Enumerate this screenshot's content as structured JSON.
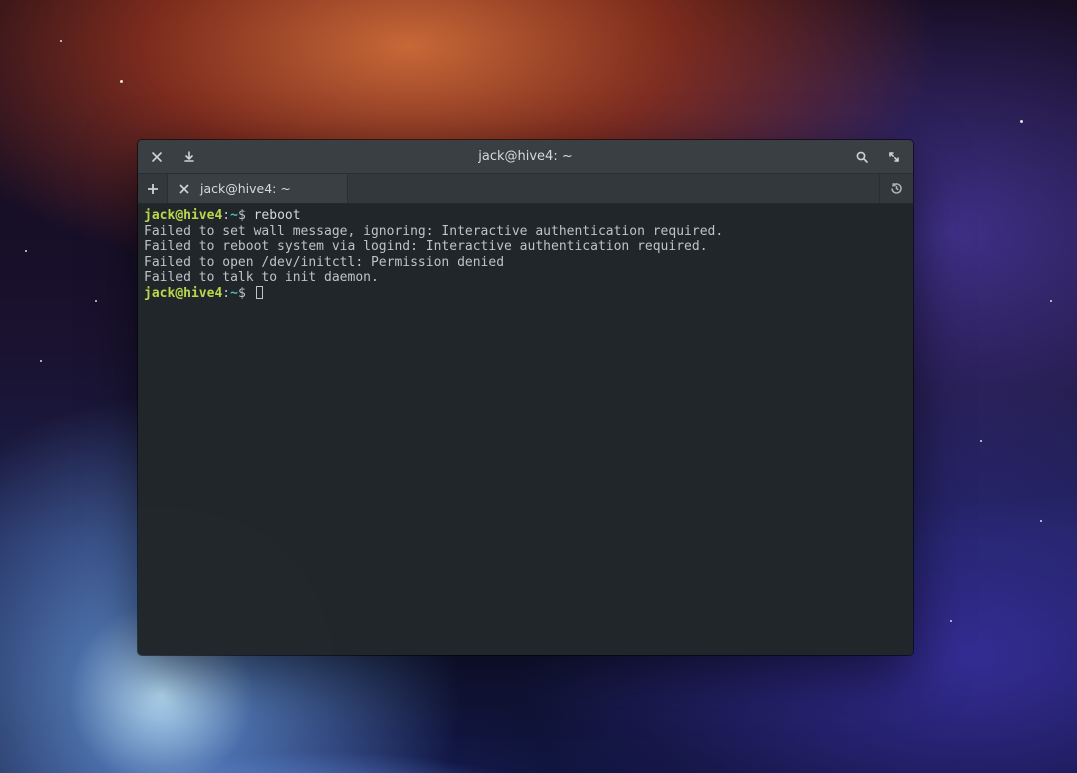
{
  "window": {
    "title": "jack@hive4: ~"
  },
  "tabs": [
    {
      "label": "jack@hive4: ~"
    }
  ],
  "prompt": {
    "user": "jack",
    "at": "@",
    "host": "hive4",
    "colon": ":",
    "path": "~",
    "dollar": "$"
  },
  "session": {
    "commands": [
      {
        "input": "reboot"
      }
    ],
    "output": [
      "Failed to set wall message, ignoring: Interactive authentication required.",
      "Failed to reboot system via logind: Interactive authentication required.",
      "Failed to open /dev/initctl: Permission denied",
      "Failed to talk to init daemon."
    ]
  },
  "icons": {
    "close": "close-icon",
    "download": "download-icon",
    "search": "search-icon",
    "fullscreen": "fullscreen-icon",
    "plus": "plus-icon",
    "history": "history-icon"
  }
}
